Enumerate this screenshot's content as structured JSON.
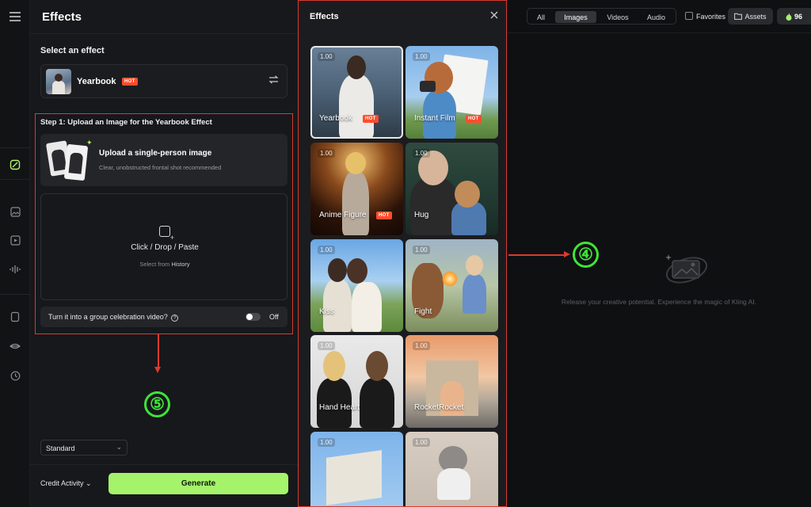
{
  "panel": {
    "title": "Effects",
    "select_label": "Select an effect",
    "selected_effect": {
      "name": "Yearbook",
      "badge": "HOT"
    },
    "step_title": "Step 1: Upload an Image for the Yearbook Effect",
    "upload_card": {
      "title": "Upload a single-person image",
      "subtitle": "Clear, unobstructed frontal shot recommended"
    },
    "dropzone": {
      "text": "Click / Drop / Paste",
      "sub_prefix": "Select from",
      "sub_link": "History"
    },
    "group_toggle": {
      "label": "Turn it into a group celebration video?",
      "state": "Off",
      "on": false
    },
    "quality": "Standard",
    "credit_activity": "Credit Activity",
    "generate": "Generate"
  },
  "effects_modal": {
    "title": "Effects",
    "tiles": [
      {
        "name": "Yearbook",
        "price": "1.00",
        "badge": "HOT",
        "selected": true
      },
      {
        "name": "Instant Film",
        "price": "1.00",
        "badge": "HOT",
        "selected": false
      },
      {
        "name": "Anime Figure",
        "price": "1.00",
        "badge": "HOT",
        "selected": false
      },
      {
        "name": "Hug",
        "price": "1.00",
        "badge": "",
        "selected": false
      },
      {
        "name": "Kiss",
        "price": "1.00",
        "badge": "",
        "selected": false
      },
      {
        "name": "Fight",
        "price": "1.00",
        "badge": "",
        "selected": false
      },
      {
        "name": "Hand Heart",
        "price": "1.00",
        "badge": "",
        "selected": false
      },
      {
        "name": "RocketRocket",
        "price": "1.00",
        "badge": "",
        "selected": false
      },
      {
        "name": "",
        "price": "1.00",
        "badge": "",
        "selected": false
      },
      {
        "name": "",
        "price": "1.00",
        "badge": "",
        "selected": false
      }
    ]
  },
  "topbar": {
    "filters": [
      "All",
      "Images",
      "Videos",
      "Audio"
    ],
    "active_filter": "Images",
    "favorites": "Favorites",
    "assets": "Assets",
    "credits": "96"
  },
  "empty_state": "Release your creative potential. Experience the magic of Kling AI.",
  "annotations": {
    "four": "④",
    "five": "⑤"
  },
  "colors": {
    "accent": "#a5f36b",
    "hot": "#ff4d2d",
    "annotation_red": "#d93a2f",
    "annotation_green": "#3ee43a"
  },
  "icons": {
    "rail": [
      "menu-icon",
      "effects-icon",
      "image-icon",
      "video-icon",
      "audio-icon",
      "frame-icon",
      "lips-icon",
      "history-icon"
    ]
  }
}
